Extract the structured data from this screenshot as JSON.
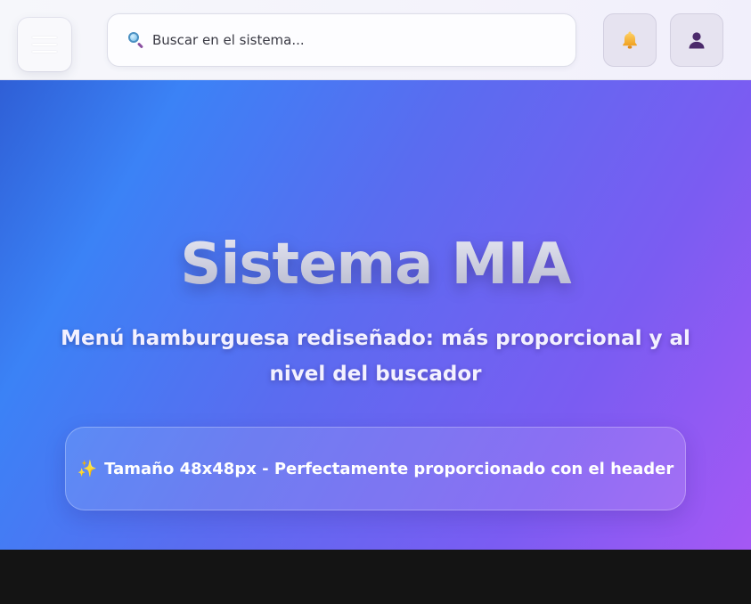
{
  "header": {
    "search": {
      "placeholder": "Buscar en el sistema..."
    },
    "icons": {
      "menu": "hamburger-icon",
      "search": "search-icon",
      "notifications": "bell-icon",
      "user": "user-icon"
    }
  },
  "hero": {
    "title": "Sistema MIA",
    "subtitle": "Menú hamburguesa rediseñado: más proporcional y al nivel del buscador",
    "card_icon": "✨",
    "card_text": "Tamaño 48x48px - Perfectamente proporcionado con el header"
  },
  "colors": {
    "hero_gradient_start": "#3b82f6",
    "hero_gradient_end": "#a855f7",
    "bell": "#f5b52e",
    "user": "#4b2a6b"
  }
}
